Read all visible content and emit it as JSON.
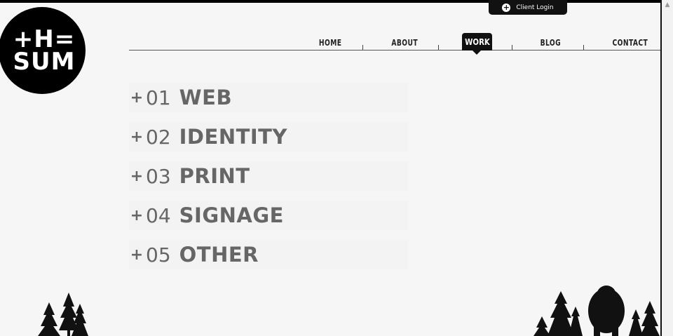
{
  "client_login": {
    "label": "Client Login"
  },
  "logo": {
    "text": "+H=\nSUM"
  },
  "nav": {
    "items": [
      {
        "label": "HOME"
      },
      {
        "label": "ABOUT"
      },
      {
        "label": "WORK",
        "active": true
      },
      {
        "label": "BLOG"
      },
      {
        "label": "CONTACT"
      }
    ]
  },
  "work": {
    "items": [
      {
        "number": "01",
        "name": "WEB"
      },
      {
        "number": "02",
        "name": "IDENTITY"
      },
      {
        "number": "03",
        "name": "PRINT"
      },
      {
        "number": "04",
        "name": "SIGNAGE"
      },
      {
        "number": "05",
        "name": "OTHER"
      }
    ]
  },
  "colors": {
    "dark": "#111111",
    "text": "#666666",
    "background": "#f6f6f6"
  },
  "icons": {
    "client_login": "plus-circle-icon",
    "scroll": "scroll-up-arrow-icon"
  }
}
